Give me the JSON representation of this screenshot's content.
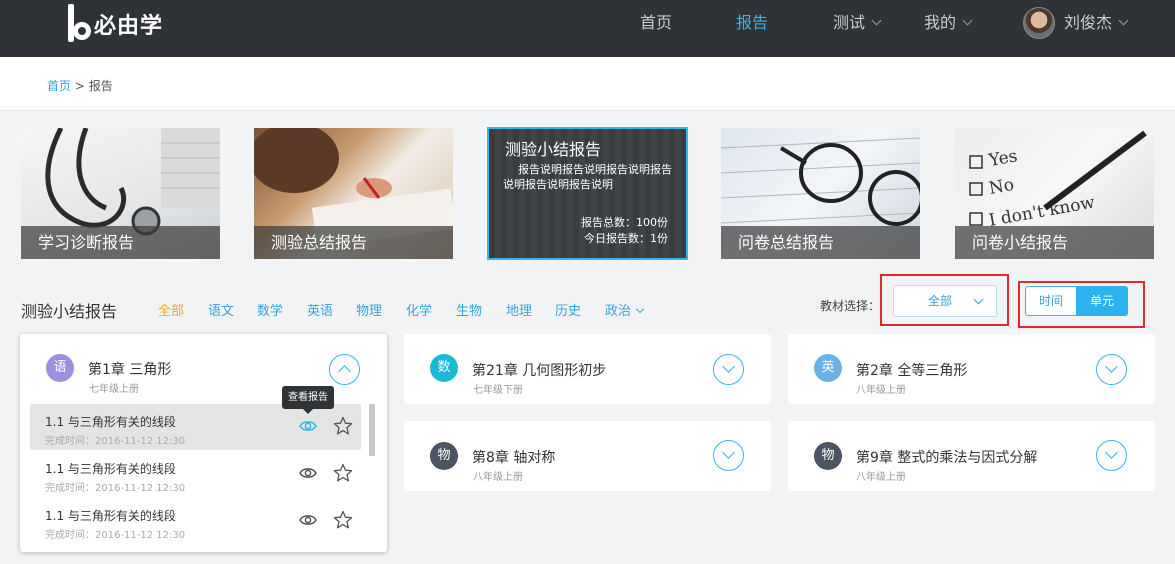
{
  "nav": {
    "logo_text": "必由学",
    "items": [
      {
        "label": "首页",
        "active": false,
        "dropdown": false
      },
      {
        "label": "报告",
        "active": true,
        "dropdown": false
      },
      {
        "label": "测试",
        "active": false,
        "dropdown": true
      },
      {
        "label": "我的",
        "active": false,
        "dropdown": true
      }
    ],
    "user_name": "刘俊杰"
  },
  "breadcrumb": {
    "home": "首页",
    "separator": ">",
    "current": "报告"
  },
  "report_cards": [
    {
      "label": "学习诊断报告"
    },
    {
      "label": "测验总结报告"
    },
    {
      "label": "测验小结报告",
      "selected": true,
      "desc_line1": "报告说明报告说明报告说明报告",
      "desc_line2": "说明报告说明报告说明",
      "total": "报告总数：100份",
      "today": "今日报告数：1份"
    },
    {
      "label": "问卷总结报告"
    },
    {
      "label": "问卷小结报告"
    }
  ],
  "section": {
    "title": "测验小结报告",
    "subjects": [
      "全部",
      "语文",
      "数学",
      "英语",
      "物理",
      "化学",
      "生物",
      "地理",
      "历史",
      "政治"
    ],
    "active_subject": "全部",
    "material_label": "教材选择：",
    "material_value": "全部",
    "sort_time": "时间",
    "sort_unit": "单元",
    "sort_active": "单元"
  },
  "chapters": [
    {
      "badge": "语",
      "badge_color": "#9b8fe0",
      "title": "第1章  三角形",
      "grade": "七年级上册",
      "expanded": true,
      "lessons": [
        {
          "title": "1.1  与三角形有关的线段",
          "time": "完成时间：2016-11-12 12:30",
          "highlighted": true
        },
        {
          "title": "1.1  与三角形有关的线段",
          "time": "完成时间：2016-11-12 12:30",
          "highlighted": false
        },
        {
          "title": "1.1  与三角形有关的线段",
          "time": "完成时间：2016-11-12 12:30",
          "highlighted": false
        }
      ]
    },
    {
      "badge": "数",
      "badge_color": "#17b9d6",
      "title": "第21章  几何图形初步",
      "grade": "七年级下册",
      "expanded": false
    },
    {
      "badge": "英",
      "badge_color": "#6ab2e6",
      "title": "第2章  全等三角形",
      "grade": "八年级上册",
      "expanded": false
    },
    {
      "badge": "物",
      "badge_color": "#4b5364",
      "title": "第8章  轴对称",
      "grade": "八年级上册",
      "expanded": false
    },
    {
      "badge": "物",
      "badge_color": "#4b5364",
      "title": "第9章  整式的乘法与因式分解",
      "grade": "八年级上册",
      "expanded": false
    }
  ],
  "tooltip": "查看报告",
  "colors": {
    "accent": "#36b5e6",
    "active_subject": "#f5a623",
    "nav_bg": "#2f3337",
    "highlight_box": "#e0282e"
  }
}
